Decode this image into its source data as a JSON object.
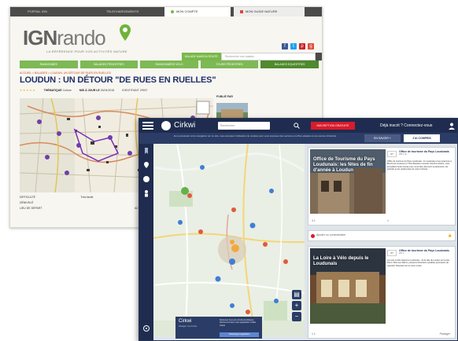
{
  "ign": {
    "topbar": {
      "link1": "PORTAIL IGN",
      "link2": "TELECHARGEMENTS",
      "link3": "MON COMPTE",
      "link4": "MON GUIDE NATURE"
    },
    "logo_ign": "IGN",
    "logo_rando": "rando",
    "tagline": "LA RÉFÉRENCE POUR VOS ACTIVITÉS NATURE",
    "search": {
      "label": "BALADE MAISON ROUTE",
      "placeholder": "Rechercher une balade..."
    },
    "nav": [
      "RANDONNÉE",
      "BALADES PEDESTRES",
      "RANDONNÉES VELO",
      "TOURS PÉDESTRES",
      "BALADES EQUESTRES"
    ],
    "breadcrumb": "ACCUEIL > BALADES > LOUDUN, UN DÉTOUR DE RUES EN RUELLES",
    "title": "LOUDUN : UN DÉTOUR \"DE RUES EN RUELLES\"",
    "meta": {
      "stars": "★★★★★",
      "author_label": "THÉMATIQUE",
      "author": "Culture",
      "updated_label": "MIS À JOUR LE",
      "updated": "26/04/2018",
      "source": "IDENTIFIANT 29907"
    },
    "side_title": "PUBLIÉ PAR",
    "bottom": {
      "r1a": "DIFFICULTÉ",
      "r1b": "Très facile",
      "r2a": "DÉNIVELÉ",
      "r3a": "LIEU DE DÉPART",
      "r3b": "ALTITUDE MIN"
    },
    "colors": {
      "green": "#7db954",
      "dark_green": "#4f8a2c",
      "title_blue": "#1f2f66",
      "crumb_orange": "#c8501e"
    }
  },
  "cirkwi": {
    "brand": "Cirkwi",
    "search_placeholder": "Rechercher",
    "signup_btn": "INSCRIPTION GRATUITE",
    "signin": "Déjà inscrit ? Connectez-vous",
    "banner_text": "En poursuivant votre navigation sur ce site, vous acceptez l'utilisation de cookies pour vous proposer des services et offres adaptés à vos centres d'intérêts.",
    "banner_btn1": "EN SAVOIR +",
    "banner_btn2": "J'AI COMPRIS",
    "promo": {
      "logo": "Cirkwi",
      "sub": "Partagez vos circuits",
      "text": "Retrouvez tous vos circuits touristiques directement dans votre application mobile Cirkwi.",
      "btn": "Télécharger l'application"
    },
    "card1": {
      "photo_title": "Office de Tourisme du Pays Loudunais: les fêtes de fin d'année à Loudun",
      "author": "Office de tourisme du Pays Loudunais",
      "stats": "295  1  40",
      "desc": "Office de tourisme du Pays Loudunais : le Loudunais et ses antennes à Monts-sur-Guesnes et Trois-Moutiers ouvertes d'avril à octobre, vous accueillent toute l'année pour vous faire découvrir le patrimoine, les activités et les randonnées de notre territoire.",
      "likes": "4   1",
      "likes2": "1"
    },
    "card2": {
      "text": "Ajouter un commentaire"
    },
    "card3": {
      "photo_title": "La Loire à Vélo depuis le Loudunais",
      "author": "Office de tourisme du Pays Loudunais",
      "stats": "281  4",
      "desc": "La Loire à Vélo depuis le Loudunais : de la ville de Loudun au Center Parcs, Bois aux Daims, plusieurs itinéraires cyclables permettent de rejoindre l'itinéraire de La Loire à Vélo.",
      "likes": "1   1",
      "share": "Partager"
    },
    "colors": {
      "header": "#1f2c4f",
      "banner": "#2b3d66",
      "red": "#d91b2a"
    }
  }
}
